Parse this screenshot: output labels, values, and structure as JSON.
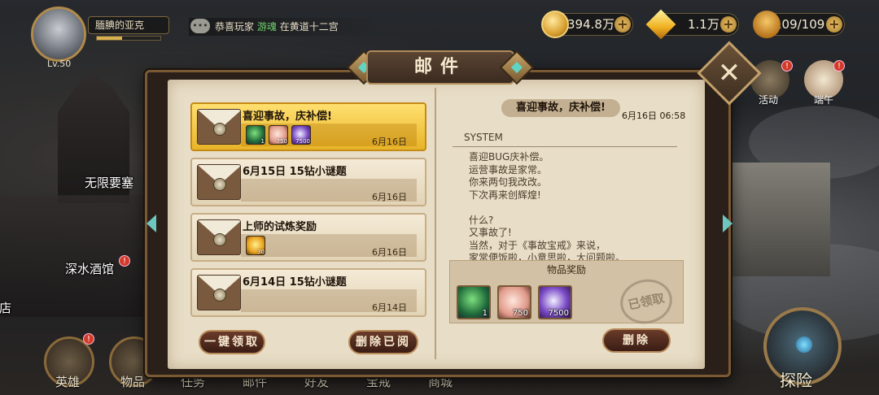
{
  "player": {
    "name": "腼腆的亚克",
    "level": "Lv.50",
    "exp_fraction": 0.4
  },
  "news": {
    "prefix": "恭喜玩家",
    "highlight": "游魂",
    "suffix": "在黄道十二宫"
  },
  "resources": {
    "gold": "394.8万",
    "diamond": "1.1万",
    "stamina": "109/109"
  },
  "side": {
    "event_label": "活动",
    "event_badge": "!",
    "festival_label": "端午",
    "festival_badge": "!"
  },
  "map": {
    "fortress": "无限要塞",
    "tavern": "深水酒馆",
    "tavern_badge": "!",
    "shop": "商店"
  },
  "nav": {
    "heroes": "英雄",
    "heroes_badge": "!",
    "items": "物品",
    "tasks": "任务",
    "mail": "邮件",
    "friends": "好友",
    "treasure": "宝戒",
    "shop": "商城",
    "explore": "探险"
  },
  "mail_panel": {
    "title": "邮件",
    "close": "✕",
    "claim_all": "一键领取",
    "delete_read": "删除已阅",
    "delete": "删除",
    "mails": [
      {
        "title": "喜迎事故，庆补偿!",
        "date": "6月16日",
        "items": [
          {
            "type": "green",
            "count": "1"
          },
          {
            "type": "pink",
            "count": "750"
          },
          {
            "type": "purple",
            "count": "7500"
          }
        ]
      },
      {
        "title": "6月15日 15钻小谜题",
        "date": "6月16日",
        "items": []
      },
      {
        "title": "上师的试炼奖励",
        "date": "6月16日",
        "items": [
          {
            "type": "dia",
            "count": "30"
          }
        ]
      },
      {
        "title": "6月14日 15钻小谜题",
        "date": "6月14日",
        "items": []
      }
    ],
    "detail": {
      "title": "喜迎事故，庆补偿!",
      "date": "6月16日 06:58",
      "sender": "SYSTEM",
      "body": [
        "喜迎BUG庆补偿。",
        "运营事故是家常。",
        "你来两句我改改。",
        "下次再来创辉煌!",
        "",
        "什么?",
        "又事故了!",
        "当然，对于《事故宝戒》来说，",
        "家常便饭啦，小意思啦，大问题啦。"
      ],
      "reward_header": "物品奖励",
      "rewards": [
        {
          "type": "green",
          "count": "1"
        },
        {
          "type": "pink",
          "count": "750"
        },
        {
          "type": "purple",
          "count": "7500"
        }
      ],
      "claimed_stamp": "已领取"
    }
  }
}
